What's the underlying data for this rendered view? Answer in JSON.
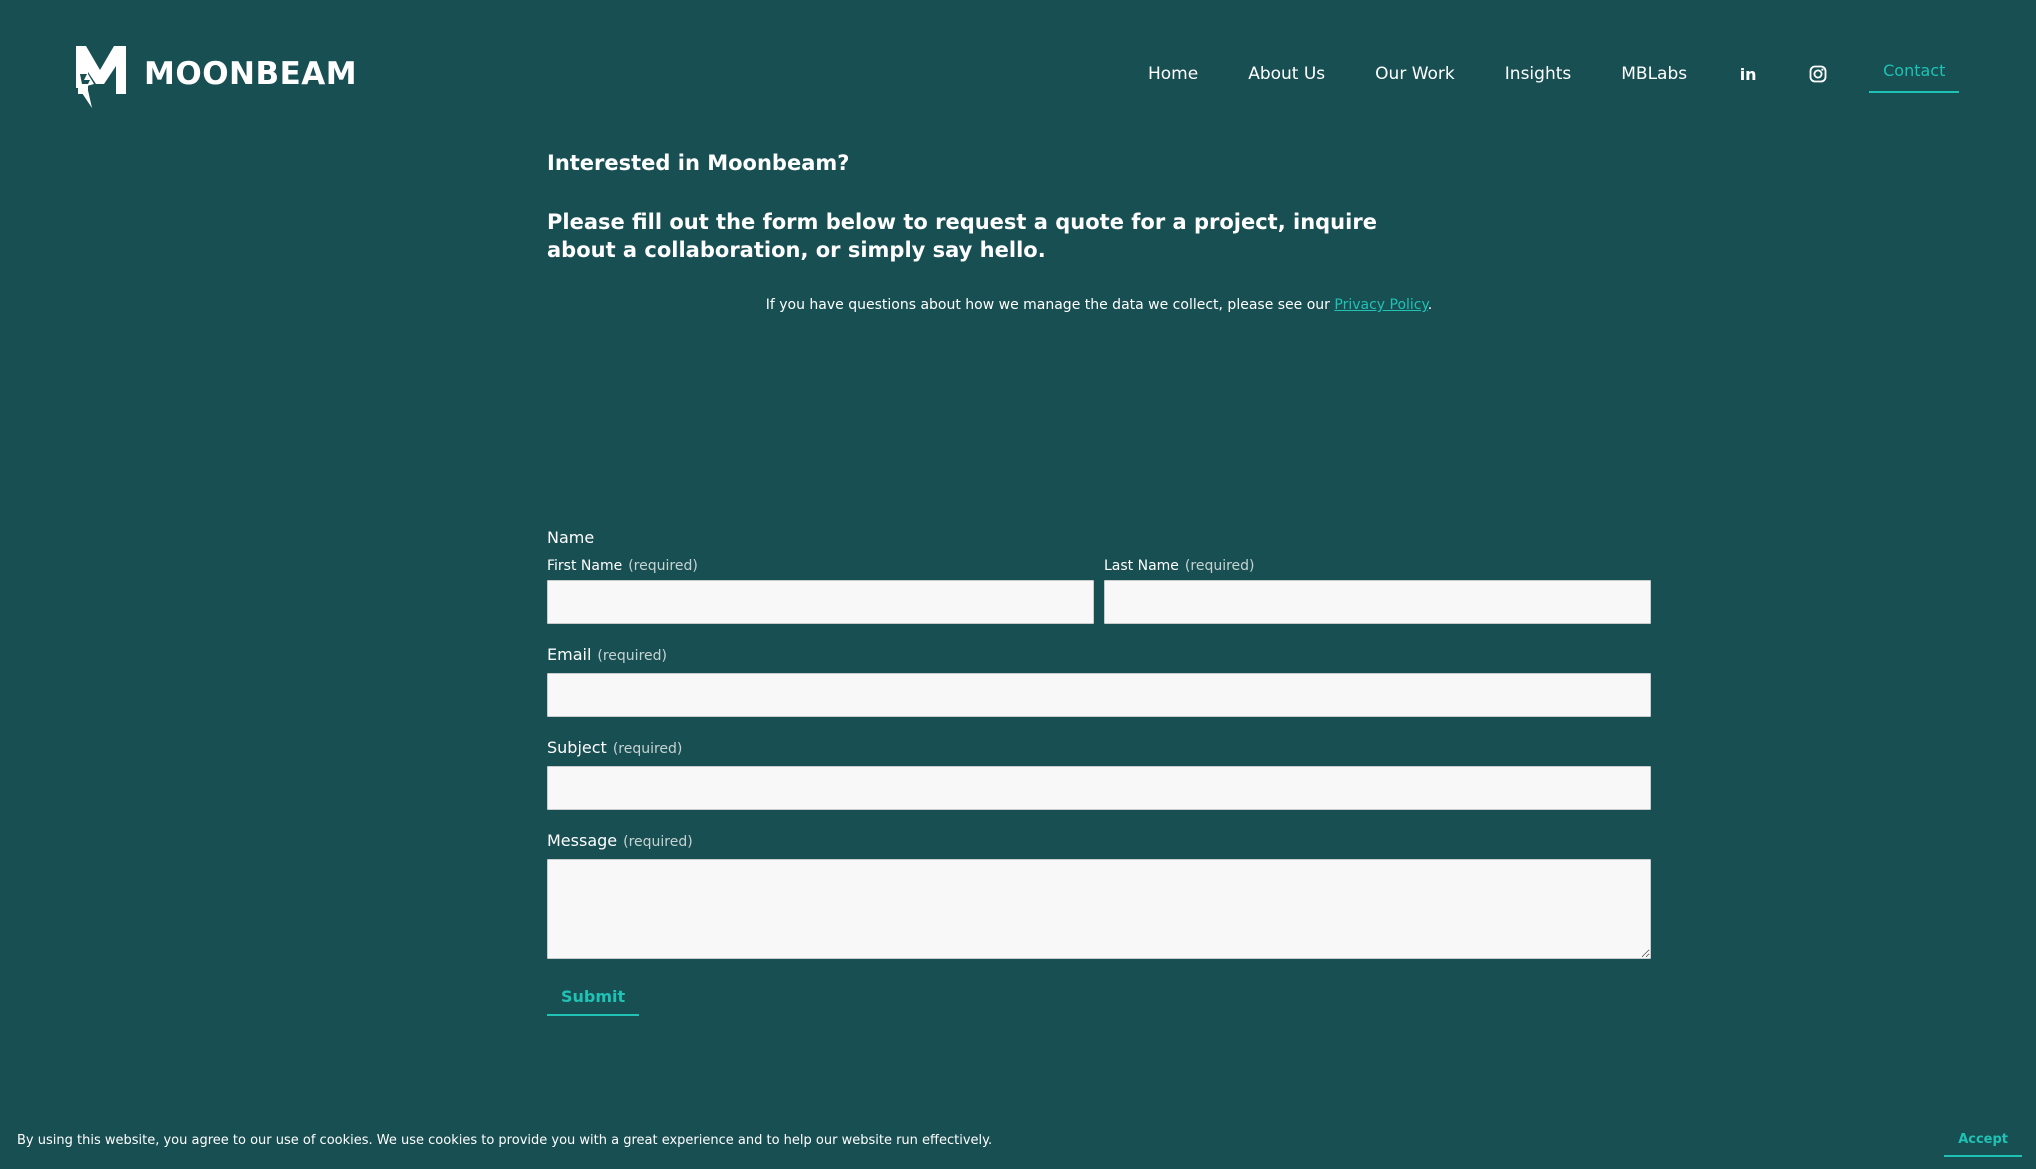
{
  "brand": {
    "name": "MOONBEAM",
    "logo_icon": "moonbeam-lightning-m-logo"
  },
  "nav": {
    "items": [
      {
        "label": "Home"
      },
      {
        "label": "About Us"
      },
      {
        "label": "Our Work"
      },
      {
        "label": "Insights"
      },
      {
        "label": "MBLabs"
      }
    ],
    "social_icons": [
      "linkedin-icon",
      "instagram-icon"
    ],
    "linkedin_glyph": "in",
    "contact_label": "Contact",
    "accent_color": "#1fc2b4"
  },
  "intro": {
    "title": "Interested in Moonbeam?",
    "subtitle": "Please fill out the form below to request a quote for a project, inquire about a collaboration, or simply say hello.",
    "privacy_prefix": "If you have questions about how we manage the data we collect, please see our ",
    "privacy_link": "Privacy Policy",
    "privacy_suffix": "."
  },
  "form": {
    "name_label": "Name",
    "first_name_label": "First Name",
    "last_name_label": "Last Name",
    "email_label": "Email",
    "subject_label": "Subject",
    "message_label": "Message",
    "required_text": "(required)",
    "first_name_value": "",
    "last_name_value": "",
    "email_value": "",
    "subject_value": "",
    "message_value": "",
    "submit_label": "Submit"
  },
  "cookie_banner": {
    "text": "By using this website, you agree to our use of cookies. We use cookies to provide you with a great experience and to help our website run effectively.",
    "accept_label": "Accept"
  },
  "colors": {
    "background": "#184f53",
    "accent": "#1fc2b4",
    "text": "#ffffff",
    "input_background": "#f8f8f8"
  }
}
